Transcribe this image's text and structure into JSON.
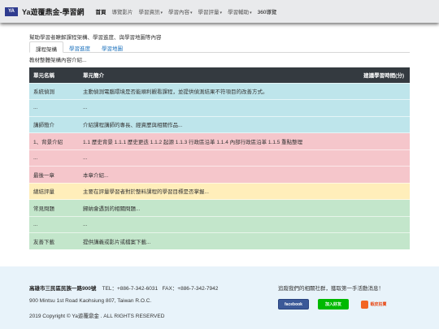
{
  "navbar": {
    "logo_text": "YA",
    "brand": "Ya遊覆鼎金-學習網",
    "items": [
      {
        "label": "首頁",
        "caret": ""
      },
      {
        "label": "導覽影片",
        "caret": ""
      },
      {
        "label": "學習資訊",
        "caret": "▾"
      },
      {
        "label": "學習內容",
        "caret": "▾"
      },
      {
        "label": "學習評量",
        "caret": "▾"
      },
      {
        "label": "學習輔助",
        "caret": "▾"
      },
      {
        "label": "360導覽",
        "caret": ""
      }
    ]
  },
  "intro": "幫助學習者瞭解課程架構、學習進度、與學習地圖等內容",
  "tabs": [
    "課程架構",
    "學習進度",
    "學習地圖"
  ],
  "tab_description": "教材整體架構內容介紹...",
  "table": {
    "headers": {
      "unit": "單元名稱",
      "summary": "單元簡介",
      "time": "建議學習時間(分)"
    },
    "rows": [
      {
        "style": "info",
        "unit": "系統偵測",
        "summary": "主動偵測電腦環境是否能順利觀看課程，並提供偵測結果不符項目的改善方式。"
      },
      {
        "style": "info",
        "unit": "...",
        "summary": "..."
      },
      {
        "style": "info",
        "unit": "講師簡介",
        "summary": "介紹課程講師的專長、經資歷與相關作品..."
      },
      {
        "style": "danger",
        "unit": "1、背景介紹",
        "summary": "1.1 歷史背景 1.1.1 歷史更迭 1.1.2 起源 1.1.3 行政區沿革 1.1.4 內部行政區沿革 1.1.5 重點整理"
      },
      {
        "style": "danger",
        "unit": "...",
        "summary": "..."
      },
      {
        "style": "danger",
        "unit": "最後一章",
        "summary": "本章介紹..."
      },
      {
        "style": "warning",
        "unit": "總結評量",
        "summary": "主要在評量學習者對於整料課程的學習目標是否掌握..."
      },
      {
        "style": "success",
        "unit": "常見問題",
        "summary": "歸納會遇到的相關問題..."
      },
      {
        "style": "success",
        "unit": "...",
        "summary": "..."
      },
      {
        "style": "success",
        "unit": "友善下載",
        "summary": "提供講義或影片或檔案下載..."
      }
    ]
  },
  "footer": {
    "address": "高雄市三民區民族一路900號",
    "phone": "TEL：+886-7-342-6031",
    "fax": "FAX：+886-7-342-7942",
    "address_en": "900 Mintsu 1st Road Kaohsiung 807, Taiwan R.O.C.",
    "copyright": "2019 Copyright © Ya遊覆鼎金 . ALL RIGHTS RESERVED",
    "social_text": "追蹤我們的相關社群，獲取第一手活動消息！",
    "badges": {
      "facebook": "facebook",
      "line": "加入好友",
      "shop": "蝦皮拍賣"
    }
  }
}
